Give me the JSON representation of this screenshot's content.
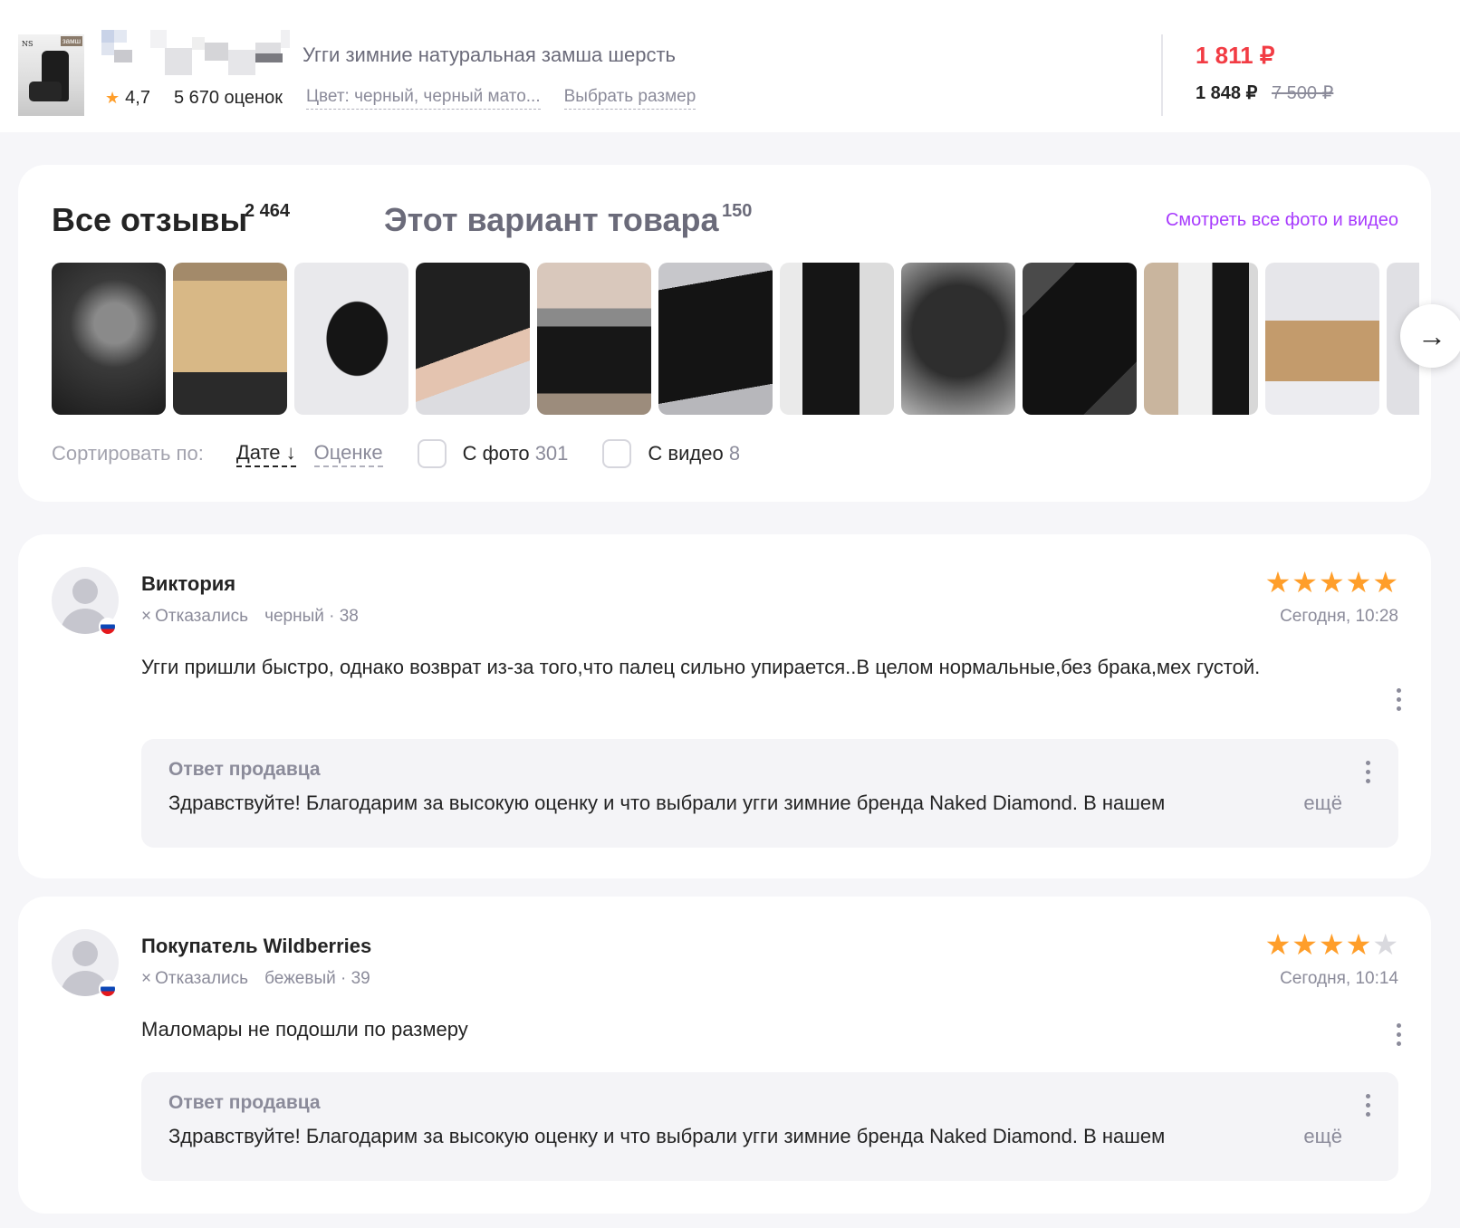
{
  "product": {
    "title": "Угги зимние натуральная замша шерсть",
    "rating": "4,7",
    "ratings_count": "5 670 оценок",
    "color": "Цвет: черный, черный мато...",
    "size_link": "Выбрать размер",
    "price": "1 811 ₽",
    "price_wallet": "1 848 ₽",
    "price_old": "7 500 ₽"
  },
  "reviews_header": {
    "tab_all": "Все отзывы",
    "tab_all_count": "2 464",
    "tab_variant": "Этот вариант товара",
    "tab_variant_count": "150",
    "see_all": "Смотреть все фото и видео",
    "sort_label": "Сортировать по:",
    "sort_date": "Дате",
    "sort_arrow": "↓",
    "sort_rating": "Оценке",
    "filter_photo": "С фото",
    "filter_photo_count": "301",
    "filter_video": "С видео",
    "filter_video_count": "8",
    "next_icon": "→"
  },
  "reviews": [
    {
      "name": "Виктория",
      "status": "Отказались",
      "variant": "черный · 38",
      "rating": 5,
      "date": "Сегодня, 10:28",
      "text": "Угги пришли быстро, однако возврат из-за того,что палец сильно упирается..В целом нормальные,без брака,мех густой.",
      "reply_title": "Ответ продавца",
      "reply_text": "Здравствуйте! Благодарим за высокую оценку и что выбрали угги зимние бренда Naked Diamond. В нашем",
      "reply_more": "ещё"
    },
    {
      "name": "Покупатель Wildberries",
      "status": "Отказались",
      "variant": "бежевый · 39",
      "rating": 4,
      "date": "Сегодня, 10:14",
      "text": "Маломары не подошли по размеру",
      "reply_title": "Ответ продавца",
      "reply_text": "Здравствуйте! Благодарим за высокую оценку и что выбрали угги зимние бренда Naked Diamond. В нашем",
      "reply_more": "ещё"
    }
  ],
  "icons": {
    "star": "★",
    "close": "×",
    "avatar": "default-user-avatar",
    "flag": "russia-flag-icon"
  },
  "colors": {
    "accent": "#a73afd",
    "price": "#f23c44",
    "star": "#ff9e2a"
  }
}
